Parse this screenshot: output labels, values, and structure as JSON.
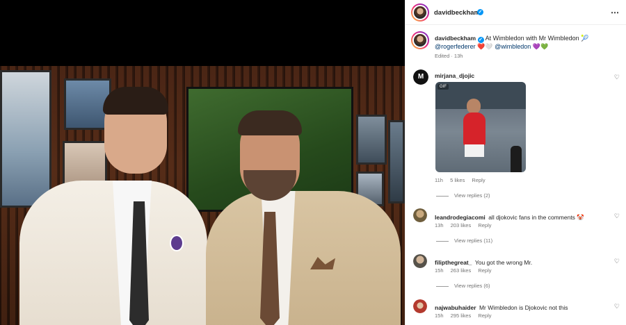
{
  "post": {
    "author": "davidbeckham",
    "caption_text": "At Wimbledon with Mr Wimbledon 🎾",
    "mention_1": "@rogerfederer",
    "caption_emoji_1": "❤️🤍",
    "mention_2": "@wimbledon",
    "caption_emoji_2": "💜💚",
    "edited_meta": "Edited · 13h",
    "more_icon": "⋯"
  },
  "comments": [
    {
      "user": "mirjana_djojic",
      "text": "",
      "time": "11h",
      "likes": "5 likes",
      "reply": "Reply",
      "view_replies": "View replies (2)",
      "gif_tag": "GIF",
      "avatar_color": "#1a1a1a"
    },
    {
      "user": "leandrodegiacomi",
      "text": "all djokovic fans in the comments 🤡",
      "time": "13h",
      "likes": "203 likes",
      "reply": "Reply",
      "view_replies": "View replies (11)",
      "avatar_color": "#8a7a5c"
    },
    {
      "user": "filipthegreat_",
      "text": "You got the wrong Mr.",
      "time": "15h",
      "likes": "263 likes",
      "reply": "Reply",
      "view_replies": "View replies (6)",
      "avatar_color": "#6d6a5e"
    },
    {
      "user": "najwabuhaider",
      "text": "Mr Wimbledon is Djokovic not this",
      "time": "15h",
      "likes": "295 likes",
      "reply": "Reply",
      "view_replies": "",
      "avatar_color": "#b33a2e"
    }
  ],
  "icons": {
    "heart": "♡",
    "verified": "✓"
  },
  "colors": {
    "verified_blue": "#0095f6",
    "mention_blue": "#00376b",
    "meta_gray": "#737373"
  }
}
